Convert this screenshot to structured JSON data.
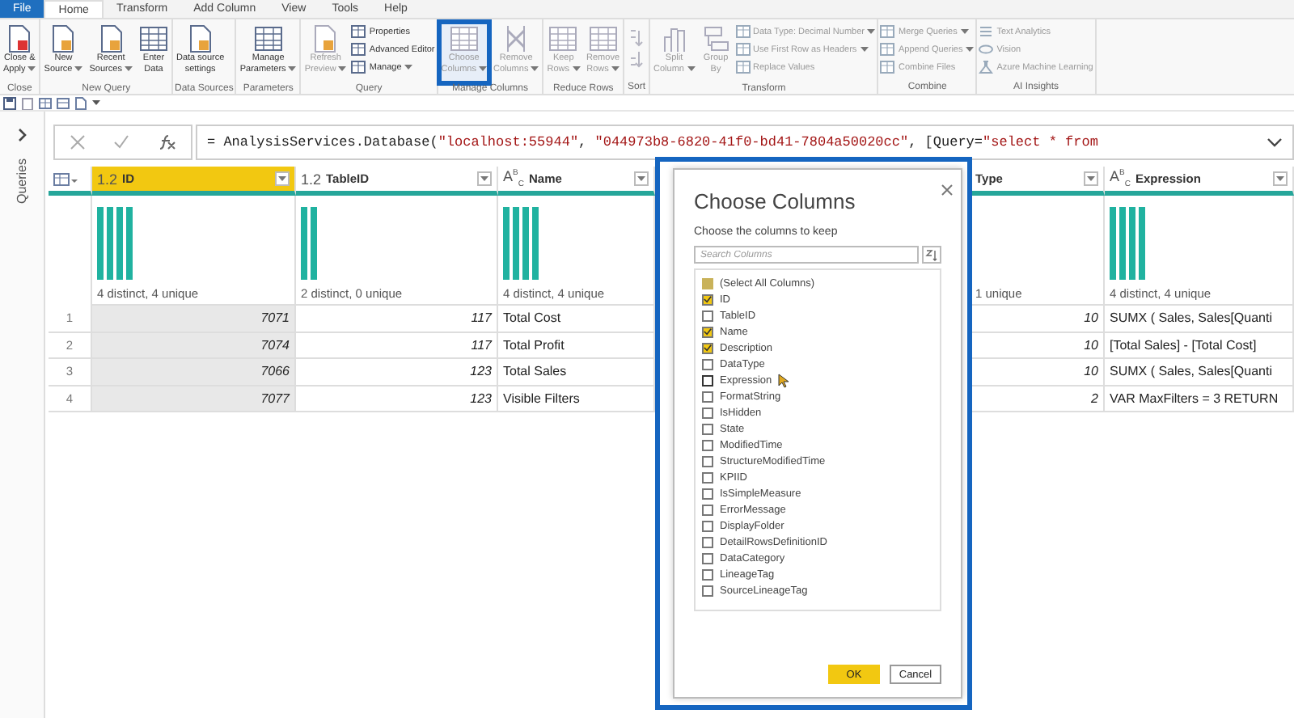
{
  "tabs": [
    {
      "label": "File",
      "kind": "file",
      "selected": false
    },
    {
      "label": "Home",
      "kind": "tab",
      "selected": true
    },
    {
      "label": "Transform",
      "kind": "tab",
      "selected": false
    },
    {
      "label": "Add Column",
      "kind": "tab",
      "selected": false
    },
    {
      "label": "View",
      "kind": "tab",
      "selected": false
    },
    {
      "label": "Tools",
      "kind": "tab",
      "selected": false
    },
    {
      "label": "Help",
      "kind": "tab",
      "selected": false
    }
  ],
  "ribbon": [
    {
      "group": "Close",
      "items": [
        {
          "kind": "large",
          "lines": [
            "Close &",
            "Apply"
          ],
          "dropdown": true,
          "disabled": false,
          "highlighted": false
        }
      ]
    },
    {
      "group": "New Query",
      "items": [
        {
          "kind": "large",
          "lines": [
            "New",
            "Source"
          ],
          "dropdown": true,
          "disabled": false,
          "highlighted": false
        },
        {
          "kind": "large",
          "lines": [
            "Recent",
            "Sources"
          ],
          "dropdown": true,
          "disabled": false,
          "highlighted": false
        },
        {
          "kind": "large",
          "lines": [
            "Enter",
            "Data"
          ],
          "dropdown": false,
          "disabled": false,
          "highlighted": false
        }
      ]
    },
    {
      "group": "Data Sources",
      "items": [
        {
          "kind": "large",
          "lines": [
            "Data source",
            "settings"
          ],
          "dropdown": false,
          "disabled": false,
          "highlighted": false
        }
      ]
    },
    {
      "group": "Parameters",
      "items": [
        {
          "kind": "large",
          "lines": [
            "Manage",
            "Parameters"
          ],
          "dropdown": true,
          "disabled": false,
          "highlighted": false
        }
      ]
    },
    {
      "group": "Query",
      "items": [
        {
          "kind": "large",
          "lines": [
            "Refresh",
            "Preview"
          ],
          "dropdown": true,
          "disabled": true,
          "highlighted": false
        },
        {
          "kind": "small",
          "label": "Properties",
          "dropdown": false,
          "disabled": false
        },
        {
          "kind": "small",
          "label": "Advanced Editor",
          "dropdown": false,
          "disabled": false
        },
        {
          "kind": "small",
          "label": "Manage",
          "dropdown": true,
          "disabled": false
        }
      ]
    },
    {
      "group": "Manage Columns",
      "items": [
        {
          "kind": "large",
          "lines": [
            "Choose",
            "Columns"
          ],
          "dropdown": true,
          "disabled": true,
          "highlighted": true
        },
        {
          "kind": "large",
          "lines": [
            "Remove",
            "Columns"
          ],
          "dropdown": true,
          "disabled": true,
          "highlighted": false
        }
      ]
    },
    {
      "group": "Reduce Rows",
      "items": [
        {
          "kind": "large",
          "lines": [
            "Keep",
            "Rows"
          ],
          "dropdown": true,
          "disabled": true,
          "highlighted": false
        },
        {
          "kind": "large",
          "lines": [
            "Remove",
            "Rows"
          ],
          "dropdown": true,
          "disabled": true,
          "highlighted": false
        }
      ]
    },
    {
      "group": "Sort",
      "items": [
        {
          "kind": "sort",
          "disabled": true
        }
      ]
    },
    {
      "group": "Transform",
      "items": [
        {
          "kind": "large",
          "lines": [
            "Split",
            "Column"
          ],
          "dropdown": true,
          "disabled": true,
          "highlighted": false
        },
        {
          "kind": "large",
          "lines": [
            "Group",
            "By"
          ],
          "dropdown": false,
          "disabled": true,
          "highlighted": false
        },
        {
          "kind": "small",
          "label": "Data Type: Decimal Number",
          "dropdown": true,
          "disabled": true
        },
        {
          "kind": "small",
          "label": "Use First Row as Headers",
          "dropdown": true,
          "disabled": true
        },
        {
          "kind": "small",
          "label": "Replace Values",
          "dropdown": false,
          "disabled": true
        }
      ]
    },
    {
      "group": "Combine",
      "items": [
        {
          "kind": "small",
          "label": "Merge Queries",
          "dropdown": true,
          "disabled": true
        },
        {
          "kind": "small",
          "label": "Append Queries",
          "dropdown": true,
          "disabled": true
        },
        {
          "kind": "small",
          "label": "Combine Files",
          "dropdown": false,
          "disabled": true
        }
      ]
    },
    {
      "group": "AI Insights",
      "items": [
        {
          "kind": "small",
          "label": "Text Analytics",
          "dropdown": false,
          "disabled": true
        },
        {
          "kind": "small",
          "label": "Vision",
          "dropdown": false,
          "disabled": true
        },
        {
          "kind": "small",
          "label": "Azure Machine Learning",
          "dropdown": false,
          "disabled": true
        }
      ]
    }
  ],
  "sidebar": {
    "label": "Queries",
    "expanded": false
  },
  "formula": [
    {
      "kind": "plain",
      "text": "= AnalysisServices.Database("
    },
    {
      "kind": "string",
      "text": "\"localhost:55944\""
    },
    {
      "kind": "plain",
      "text": ", "
    },
    {
      "kind": "string",
      "text": "\"044973b8-6820-41f0-bd41-7804a50020cc\""
    },
    {
      "kind": "plain",
      "text": ", [Query="
    },
    {
      "kind": "string",
      "text": "\"select * from"
    }
  ],
  "table": {
    "columns": [
      {
        "type_label": "1.2",
        "name": "ID",
        "kind": "number",
        "selected": true,
        "profile": "4 distinct, 4 unique"
      },
      {
        "type_label": "1.2",
        "name": "TableID",
        "kind": "number",
        "selected": false,
        "profile": "2 distinct, 0 unique"
      },
      {
        "type_label": "A$^{B}$$_{C}$",
        "name": "Name",
        "kind": "text",
        "selected": false,
        "profile": "4 distinct, 4 unique"
      },
      {
        "name": "Type",
        "kind": "number",
        "selected": false,
        "profile": "1 unique"
      },
      {
        "type_label": "A$^{B}$$_{C}$",
        "name": "Expression",
        "kind": "text",
        "selected": false,
        "profile": "4 distinct, 4 unique"
      }
    ],
    "rows": [
      {
        "number": "1",
        "cells": [
          "7071",
          "117",
          "Total Cost",
          "10",
          "SUMX ( Sales, Sales[Quanti"
        ]
      },
      {
        "number": "2",
        "cells": [
          "7074",
          "117",
          "Total Profit",
          "10",
          "[Total Sales] - [Total Cost]"
        ]
      },
      {
        "number": "3",
        "cells": [
          "7066",
          "123",
          "Total Sales",
          "10",
          "SUMX ( Sales, Sales[Quanti"
        ]
      },
      {
        "number": "4",
        "cells": [
          "7077",
          "123",
          "Visible Filters",
          "2",
          "VAR MaxFilters = 3 RETURN"
        ]
      }
    ]
  },
  "dialog": {
    "title": "Choose Columns",
    "subtitle": "Choose the columns to keep",
    "search": {
      "placeholder": "Search Columns"
    },
    "highlighted": true,
    "select_all": {
      "label": "(Select All Columns)",
      "checked": false,
      "indeterminate": true
    },
    "items": [
      {
        "label": "ID",
        "checked": true,
        "hovered": false
      },
      {
        "label": "TableID",
        "checked": false,
        "hovered": false
      },
      {
        "label": "Name",
        "checked": true,
        "hovered": false
      },
      {
        "label": "Description",
        "checked": true,
        "hovered": false
      },
      {
        "label": "DataType",
        "checked": false,
        "hovered": false
      },
      {
        "label": "Expression",
        "checked": false,
        "hovered": true
      },
      {
        "label": "FormatString",
        "checked": false,
        "hovered": false
      },
      {
        "label": "IsHidden",
        "checked": false,
        "hovered": false
      },
      {
        "label": "State",
        "checked": false,
        "hovered": false
      },
      {
        "label": "ModifiedTime",
        "checked": false,
        "hovered": false
      },
      {
        "label": "StructureModifiedTime",
        "checked": false,
        "hovered": false
      },
      {
        "label": "KPIID",
        "checked": false,
        "hovered": false
      },
      {
        "label": "IsSimpleMeasure",
        "checked": false,
        "hovered": false
      },
      {
        "label": "ErrorMessage",
        "checked": false,
        "hovered": false
      },
      {
        "label": "DisplayFolder",
        "checked": false,
        "hovered": false
      },
      {
        "label": "DetailRowsDefinitionID",
        "checked": false,
        "hovered": false
      },
      {
        "label": "DataCategory",
        "checked": false,
        "hovered": false
      },
      {
        "label": "LineageTag",
        "checked": false,
        "hovered": false
      },
      {
        "label": "SourceLineageTag",
        "checked": false,
        "hovered": false
      }
    ],
    "buttons": [
      {
        "label": "OK",
        "kind": "primary"
      },
      {
        "label": "Cancel",
        "kind": "secondary"
      }
    ]
  }
}
